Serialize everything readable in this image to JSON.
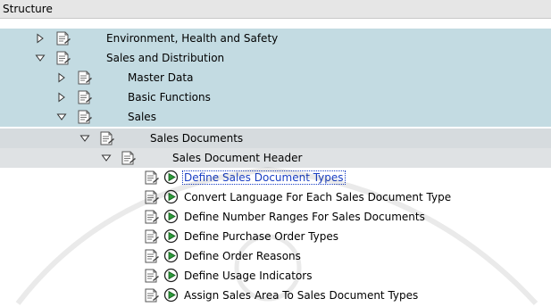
{
  "structure": {
    "header": "Structure"
  },
  "tree": {
    "environment": "Environment, Health and Safety",
    "sales_distribution": "Sales and Distribution",
    "master_data": "Master Data",
    "basic_functions": "Basic Functions",
    "sales": "Sales",
    "sales_documents": "Sales Documents",
    "sales_document_header": "Sales Document Header",
    "leaves": [
      "Define Sales Document Types",
      "Convert Language For Each Sales Document Type",
      "Define Number Ranges For Sales Documents",
      "Define Purchase Order Types",
      "Define Order Reasons",
      "Define Usage Indicators",
      "Assign Sales Area To Sales Document Types"
    ]
  },
  "colors": {
    "row_blue": "#c3dbe2",
    "row_grey": "#d6dbde",
    "selected_link": "#1a3fc4"
  },
  "icons": {
    "collapsed": "triangle-right-icon",
    "expanded": "triangle-down-icon",
    "document": "document-icon",
    "execute": "execute-clock-icon"
  }
}
